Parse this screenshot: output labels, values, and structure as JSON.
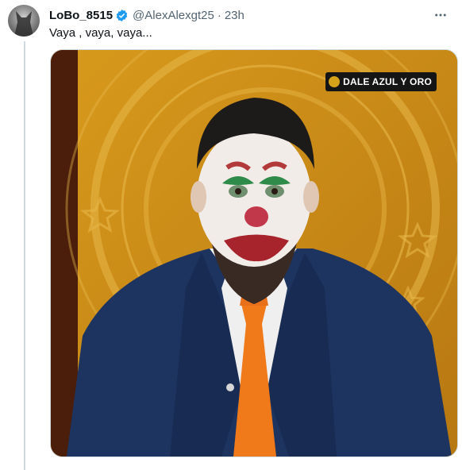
{
  "tweet": {
    "display_name": "LoBo_8515",
    "handle": "@AlexAlexgt25",
    "separator": "·",
    "time": "23h",
    "text": "Vaya , vaya, vaya..."
  },
  "media": {
    "watermark_text": "DALE AZUL Y ORO",
    "subject": "man-with-clown-makeup-in-suit"
  },
  "icons": {
    "verified": "verified-badge-icon",
    "more": "more-options-icon"
  },
  "colors": {
    "verified": "#1d9bf0",
    "secondary_text": "#536471",
    "background_gold": "#c58a16",
    "suit": "#1e3460",
    "tie": "#f07a1a"
  }
}
